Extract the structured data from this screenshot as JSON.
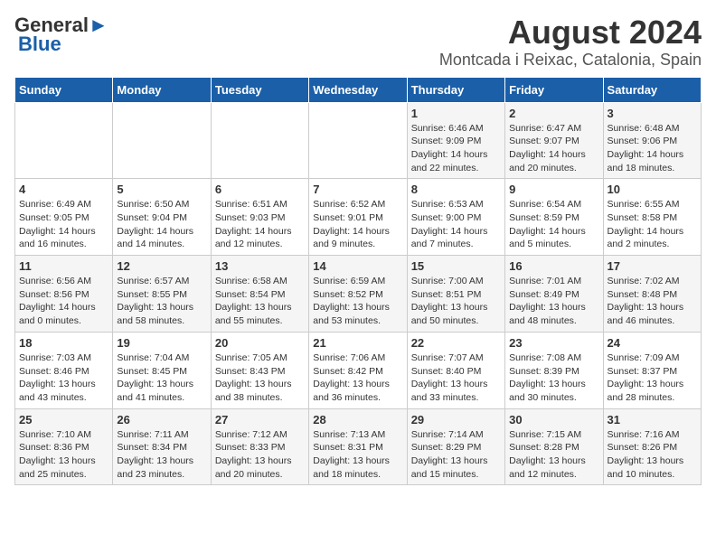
{
  "logo": {
    "line1": "General",
    "line2": "Blue"
  },
  "title": "August 2024",
  "subtitle": "Montcada i Reixac, Catalonia, Spain",
  "headers": [
    "Sunday",
    "Monday",
    "Tuesday",
    "Wednesday",
    "Thursday",
    "Friday",
    "Saturday"
  ],
  "weeks": [
    [
      {
        "num": "",
        "info": ""
      },
      {
        "num": "",
        "info": ""
      },
      {
        "num": "",
        "info": ""
      },
      {
        "num": "",
        "info": ""
      },
      {
        "num": "1",
        "info": "Sunrise: 6:46 AM\nSunset: 9:09 PM\nDaylight: 14 hours\nand 22 minutes."
      },
      {
        "num": "2",
        "info": "Sunrise: 6:47 AM\nSunset: 9:07 PM\nDaylight: 14 hours\nand 20 minutes."
      },
      {
        "num": "3",
        "info": "Sunrise: 6:48 AM\nSunset: 9:06 PM\nDaylight: 14 hours\nand 18 minutes."
      }
    ],
    [
      {
        "num": "4",
        "info": "Sunrise: 6:49 AM\nSunset: 9:05 PM\nDaylight: 14 hours\nand 16 minutes."
      },
      {
        "num": "5",
        "info": "Sunrise: 6:50 AM\nSunset: 9:04 PM\nDaylight: 14 hours\nand 14 minutes."
      },
      {
        "num": "6",
        "info": "Sunrise: 6:51 AM\nSunset: 9:03 PM\nDaylight: 14 hours\nand 12 minutes."
      },
      {
        "num": "7",
        "info": "Sunrise: 6:52 AM\nSunset: 9:01 PM\nDaylight: 14 hours\nand 9 minutes."
      },
      {
        "num": "8",
        "info": "Sunrise: 6:53 AM\nSunset: 9:00 PM\nDaylight: 14 hours\nand 7 minutes."
      },
      {
        "num": "9",
        "info": "Sunrise: 6:54 AM\nSunset: 8:59 PM\nDaylight: 14 hours\nand 5 minutes."
      },
      {
        "num": "10",
        "info": "Sunrise: 6:55 AM\nSunset: 8:58 PM\nDaylight: 14 hours\nand 2 minutes."
      }
    ],
    [
      {
        "num": "11",
        "info": "Sunrise: 6:56 AM\nSunset: 8:56 PM\nDaylight: 14 hours\nand 0 minutes."
      },
      {
        "num": "12",
        "info": "Sunrise: 6:57 AM\nSunset: 8:55 PM\nDaylight: 13 hours\nand 58 minutes."
      },
      {
        "num": "13",
        "info": "Sunrise: 6:58 AM\nSunset: 8:54 PM\nDaylight: 13 hours\nand 55 minutes."
      },
      {
        "num": "14",
        "info": "Sunrise: 6:59 AM\nSunset: 8:52 PM\nDaylight: 13 hours\nand 53 minutes."
      },
      {
        "num": "15",
        "info": "Sunrise: 7:00 AM\nSunset: 8:51 PM\nDaylight: 13 hours\nand 50 minutes."
      },
      {
        "num": "16",
        "info": "Sunrise: 7:01 AM\nSunset: 8:49 PM\nDaylight: 13 hours\nand 48 minutes."
      },
      {
        "num": "17",
        "info": "Sunrise: 7:02 AM\nSunset: 8:48 PM\nDaylight: 13 hours\nand 46 minutes."
      }
    ],
    [
      {
        "num": "18",
        "info": "Sunrise: 7:03 AM\nSunset: 8:46 PM\nDaylight: 13 hours\nand 43 minutes."
      },
      {
        "num": "19",
        "info": "Sunrise: 7:04 AM\nSunset: 8:45 PM\nDaylight: 13 hours\nand 41 minutes."
      },
      {
        "num": "20",
        "info": "Sunrise: 7:05 AM\nSunset: 8:43 PM\nDaylight: 13 hours\nand 38 minutes."
      },
      {
        "num": "21",
        "info": "Sunrise: 7:06 AM\nSunset: 8:42 PM\nDaylight: 13 hours\nand 36 minutes."
      },
      {
        "num": "22",
        "info": "Sunrise: 7:07 AM\nSunset: 8:40 PM\nDaylight: 13 hours\nand 33 minutes."
      },
      {
        "num": "23",
        "info": "Sunrise: 7:08 AM\nSunset: 8:39 PM\nDaylight: 13 hours\nand 30 minutes."
      },
      {
        "num": "24",
        "info": "Sunrise: 7:09 AM\nSunset: 8:37 PM\nDaylight: 13 hours\nand 28 minutes."
      }
    ],
    [
      {
        "num": "25",
        "info": "Sunrise: 7:10 AM\nSunset: 8:36 PM\nDaylight: 13 hours\nand 25 minutes."
      },
      {
        "num": "26",
        "info": "Sunrise: 7:11 AM\nSunset: 8:34 PM\nDaylight: 13 hours\nand 23 minutes."
      },
      {
        "num": "27",
        "info": "Sunrise: 7:12 AM\nSunset: 8:33 PM\nDaylight: 13 hours\nand 20 minutes."
      },
      {
        "num": "28",
        "info": "Sunrise: 7:13 AM\nSunset: 8:31 PM\nDaylight: 13 hours\nand 18 minutes."
      },
      {
        "num": "29",
        "info": "Sunrise: 7:14 AM\nSunset: 8:29 PM\nDaylight: 13 hours\nand 15 minutes."
      },
      {
        "num": "30",
        "info": "Sunrise: 7:15 AM\nSunset: 8:28 PM\nDaylight: 13 hours\nand 12 minutes."
      },
      {
        "num": "31",
        "info": "Sunrise: 7:16 AM\nSunset: 8:26 PM\nDaylight: 13 hours\nand 10 minutes."
      }
    ]
  ]
}
